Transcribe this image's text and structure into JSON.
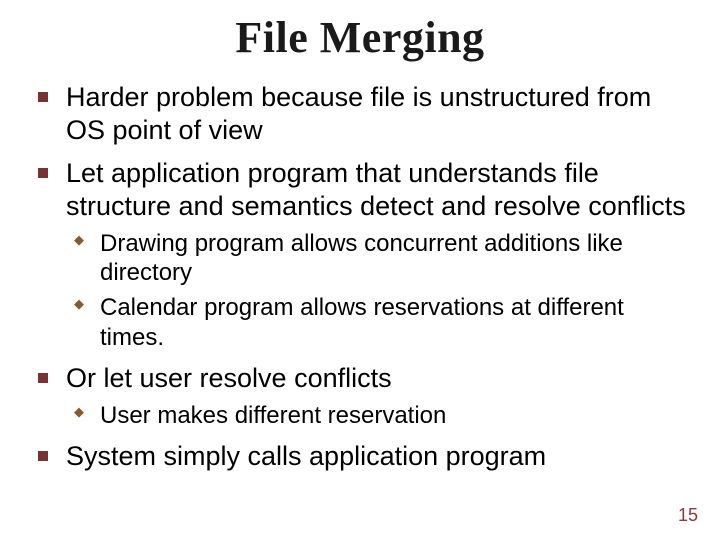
{
  "title": "File Merging",
  "bullets": {
    "b1": "Harder problem because file is unstructured from OS point of view",
    "b2": "Let application program that understands file structure and semantics  detect and resolve conflicts",
    "b2_sub": {
      "s1": "Drawing program allows concurrent additions like directory",
      "s2": "Calendar program allows reservations at different times."
    },
    "b3": "Or let user resolve conflicts",
    "b3_sub": {
      "s1": "User makes different reservation"
    },
    "b4": "System simply calls application program"
  },
  "pagenum": "15"
}
